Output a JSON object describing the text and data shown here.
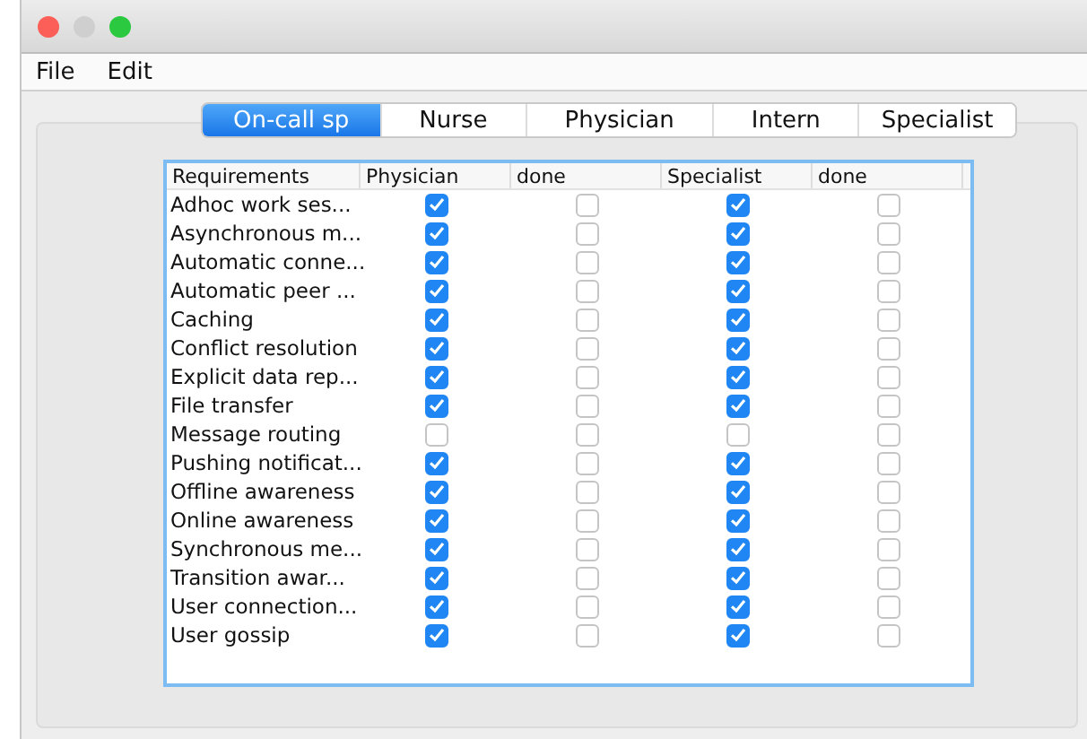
{
  "menu": [
    "File",
    "Edit"
  ],
  "tabs": [
    {
      "label": "On-call sp",
      "selected": true
    },
    {
      "label": "Nurse",
      "selected": false
    },
    {
      "label": "Physician",
      "selected": false
    },
    {
      "label": "Intern",
      "selected": false
    },
    {
      "label": "Specialist",
      "selected": false
    }
  ],
  "table": {
    "columns": [
      "Requirements",
      "Physician",
      "done",
      "Specialist",
      "done"
    ],
    "rows": [
      {
        "name": "Adhoc work ses...",
        "checks": [
          true,
          false,
          true,
          false
        ]
      },
      {
        "name": "Asynchronous m...",
        "checks": [
          true,
          false,
          true,
          false
        ]
      },
      {
        "name": "Automatic conne...",
        "checks": [
          true,
          false,
          true,
          false
        ]
      },
      {
        "name": "Automatic peer ...",
        "checks": [
          true,
          false,
          true,
          false
        ]
      },
      {
        "name": "Caching",
        "checks": [
          true,
          false,
          true,
          false
        ]
      },
      {
        "name": "Conflict resolution",
        "checks": [
          true,
          false,
          true,
          false
        ]
      },
      {
        "name": "Explicit data rep...",
        "checks": [
          true,
          false,
          true,
          false
        ]
      },
      {
        "name": "File transfer",
        "checks": [
          true,
          false,
          true,
          false
        ]
      },
      {
        "name": "Message routing",
        "checks": [
          false,
          false,
          false,
          false
        ]
      },
      {
        "name": "Pushing notificat...",
        "checks": [
          true,
          false,
          true,
          false
        ]
      },
      {
        "name": "Offline awareness",
        "checks": [
          true,
          false,
          true,
          false
        ]
      },
      {
        "name": "Online awareness",
        "checks": [
          true,
          false,
          true,
          false
        ]
      },
      {
        "name": "Synchronous me...",
        "checks": [
          true,
          false,
          true,
          false
        ]
      },
      {
        "name": "Transition awar...",
        "checks": [
          true,
          false,
          true,
          false
        ]
      },
      {
        "name": "User connection...",
        "checks": [
          true,
          false,
          true,
          false
        ]
      },
      {
        "name": "User gossip",
        "checks": [
          true,
          false,
          true,
          false
        ]
      }
    ]
  }
}
